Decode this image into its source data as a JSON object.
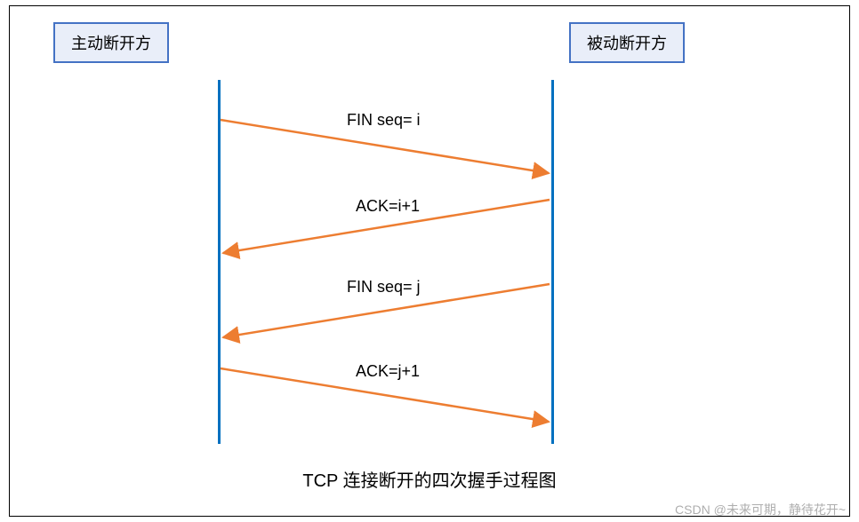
{
  "chart_data": {
    "type": "sequence",
    "title": "TCP 连接断开的四次握手过程图",
    "actors": [
      {
        "id": "active",
        "label": "主动断开方"
      },
      {
        "id": "passive",
        "label": "被动断开方"
      }
    ],
    "messages": [
      {
        "from": "active",
        "to": "passive",
        "label": "FIN seq= i"
      },
      {
        "from": "passive",
        "to": "active",
        "label": "ACK=i+1"
      },
      {
        "from": "passive",
        "to": "active",
        "label": "FIN seq= j"
      },
      {
        "from": "active",
        "to": "passive",
        "label": "ACK=j+1"
      }
    ]
  },
  "watermark": "CSDN @未来可期，静待花开~"
}
